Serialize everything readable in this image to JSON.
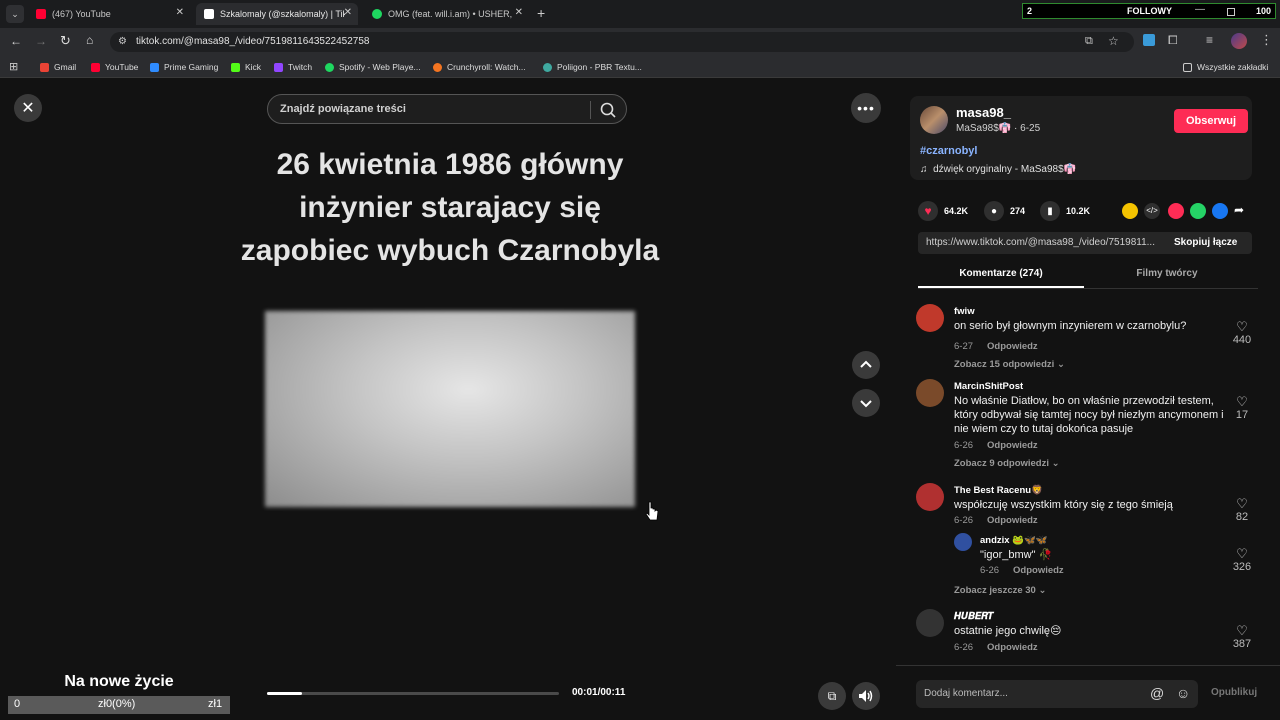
{
  "browser": {
    "tabs": [
      {
        "title": "(467) YouTube",
        "color": "#ff0033"
      },
      {
        "title": "Szkalomaly (@szkalomaly) | Tik",
        "color": "#ffffff"
      },
      {
        "title": "OMG (feat. will.i.am) • USHER,",
        "color": "#1ed760"
      }
    ],
    "new_tab": "+",
    "url": "tiktok.com/@masa98_/video/7519811643522452758",
    "bookmarks": [
      {
        "label": "Gmail",
        "color": "#ea4335"
      },
      {
        "label": "YouTube",
        "color": "#ff0033"
      },
      {
        "label": "Prime Gaming",
        "color": "#2f8cff"
      },
      {
        "label": "Kick",
        "color": "#53fc18"
      },
      {
        "label": "Twitch",
        "color": "#9146ff"
      },
      {
        "label": "Spotify - Web Playe...",
        "color": "#1ed760"
      },
      {
        "label": "Crunchyroll: Watch...",
        "color": "#f47521"
      },
      {
        "label": "Poliigon - PBR Textu...",
        "color": "#3fa9a0"
      }
    ],
    "all_bookmarks": "Wszystkie zakładki"
  },
  "followy_widget": {
    "count": "2",
    "label": "FOLLOWY",
    "goal": "100"
  },
  "player": {
    "search_placeholder": "Znajdź powiązane treści",
    "caption": "26 kwietnia 1986 główny inżynier starajacy się zapobiec wybuch Czarnobyla",
    "time": "00:01/00:11",
    "progress": 0.12
  },
  "overlay": {
    "title": "Na nowe życie",
    "left": "0",
    "center": "zł0(0%)",
    "right": "zł1"
  },
  "video_info": {
    "username": "masa98_",
    "meta": "MaSa98$👘 · 6-25",
    "follow_label": "Obserwuj",
    "hashtag": "#czarnobyl",
    "sound": "dźwięk oryginalny - MaSa98$👘",
    "likes": "64.2K",
    "comments_count": "274",
    "saves": "10.2K",
    "link": "https://www.tiktok.com/@masa98_/video/7519811...",
    "copy_link": "Skopiuj łącze"
  },
  "tabs": {
    "comments": "Komentarze (274)",
    "creator_videos": "Filmy twórcy"
  },
  "comments": [
    {
      "user": "fwiw",
      "text": "on serio był głownym inzynierem w czarnobylu?",
      "date": "6-27",
      "reply": "Odpowiedz",
      "likes": "440",
      "more": "Zobacz 15 odpowiedzi",
      "avatar": "#c0392b"
    },
    {
      "user": "MarcinShitPost",
      "text": "No właśnie Diatłow, bo on właśnie przewodził testem, który odbywał się tamtej nocy był niezłym ancymonem i nie wiem czy to tutaj dokońca pasuje",
      "date": "6-26",
      "reply": "Odpowiedz",
      "likes": "17",
      "more": "Zobacz 9 odpowiedzi",
      "avatar": "#7a4a2a"
    },
    {
      "user": "The Best Racenu🦁",
      "text": "współczuję wszystkim który się z tego śmieją",
      "date": "6-26",
      "reply": "Odpowiedz",
      "likes": "82",
      "avatar": "#b03030"
    },
    {
      "user": "andzix 🐸🦋🦋",
      "text": "\"igor_bmw\" 🥀",
      "date": "6-26",
      "reply": "Odpowiedz",
      "likes": "326",
      "more": "Zobacz jeszcze 30",
      "avatar": "#3050a0"
    },
    {
      "user": "𝑯𝑼𝑩𝑬𝑹𝑻",
      "text": "ostatnie jego chwilę😔",
      "date": "6-26",
      "reply": "Odpowiedz",
      "likes": "387",
      "avatar": "#333333"
    }
  ],
  "input": {
    "placeholder": "Dodaj komentarz...",
    "at": "@",
    "emoji": "☺",
    "publish": "Opublikuj"
  }
}
